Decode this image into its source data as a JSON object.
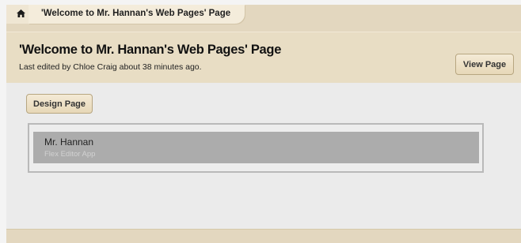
{
  "breadcrumb": {
    "home_icon": "home-icon",
    "current": "'Welcome to Mr. Hannan's Web Pages' Page"
  },
  "header": {
    "title": "'Welcome to Mr. Hannan's Web Pages' Page",
    "subtitle": "Last edited by Chloe Craig about 38 minutes ago.",
    "view_button": "View Page"
  },
  "content": {
    "design_button": "Design Page",
    "apps": [
      {
        "name": "Mr. Hannan",
        "type": "Flex Editor App"
      }
    ]
  },
  "colors": {
    "header_bg": "#e8ddc4",
    "crumb_bg": "#e3d7bf",
    "app_item_bg": "#acacac"
  }
}
